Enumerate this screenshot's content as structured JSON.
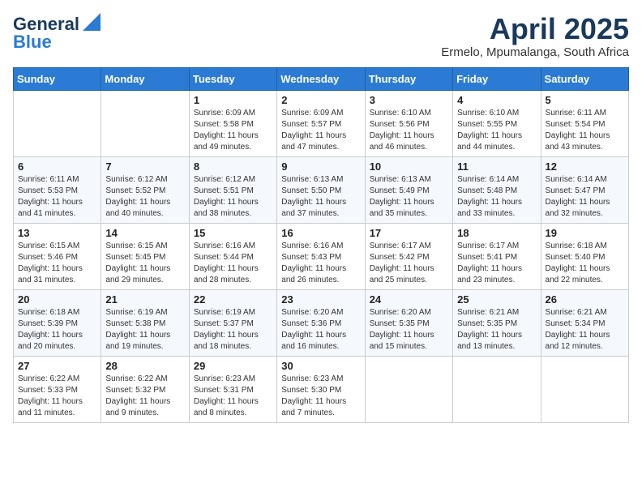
{
  "logo": {
    "line1": "General",
    "line2": "Blue"
  },
  "title": "April 2025",
  "location": "Ermelo, Mpumalanga, South Africa",
  "days_of_week": [
    "Sunday",
    "Monday",
    "Tuesday",
    "Wednesday",
    "Thursday",
    "Friday",
    "Saturday"
  ],
  "weeks": [
    [
      {
        "day": "",
        "info": ""
      },
      {
        "day": "",
        "info": ""
      },
      {
        "day": "1",
        "info": "Sunrise: 6:09 AM\nSunset: 5:58 PM\nDaylight: 11 hours and 49 minutes."
      },
      {
        "day": "2",
        "info": "Sunrise: 6:09 AM\nSunset: 5:57 PM\nDaylight: 11 hours and 47 minutes."
      },
      {
        "day": "3",
        "info": "Sunrise: 6:10 AM\nSunset: 5:56 PM\nDaylight: 11 hours and 46 minutes."
      },
      {
        "day": "4",
        "info": "Sunrise: 6:10 AM\nSunset: 5:55 PM\nDaylight: 11 hours and 44 minutes."
      },
      {
        "day": "5",
        "info": "Sunrise: 6:11 AM\nSunset: 5:54 PM\nDaylight: 11 hours and 43 minutes."
      }
    ],
    [
      {
        "day": "6",
        "info": "Sunrise: 6:11 AM\nSunset: 5:53 PM\nDaylight: 11 hours and 41 minutes."
      },
      {
        "day": "7",
        "info": "Sunrise: 6:12 AM\nSunset: 5:52 PM\nDaylight: 11 hours and 40 minutes."
      },
      {
        "day": "8",
        "info": "Sunrise: 6:12 AM\nSunset: 5:51 PM\nDaylight: 11 hours and 38 minutes."
      },
      {
        "day": "9",
        "info": "Sunrise: 6:13 AM\nSunset: 5:50 PM\nDaylight: 11 hours and 37 minutes."
      },
      {
        "day": "10",
        "info": "Sunrise: 6:13 AM\nSunset: 5:49 PM\nDaylight: 11 hours and 35 minutes."
      },
      {
        "day": "11",
        "info": "Sunrise: 6:14 AM\nSunset: 5:48 PM\nDaylight: 11 hours and 33 minutes."
      },
      {
        "day": "12",
        "info": "Sunrise: 6:14 AM\nSunset: 5:47 PM\nDaylight: 11 hours and 32 minutes."
      }
    ],
    [
      {
        "day": "13",
        "info": "Sunrise: 6:15 AM\nSunset: 5:46 PM\nDaylight: 11 hours and 31 minutes."
      },
      {
        "day": "14",
        "info": "Sunrise: 6:15 AM\nSunset: 5:45 PM\nDaylight: 11 hours and 29 minutes."
      },
      {
        "day": "15",
        "info": "Sunrise: 6:16 AM\nSunset: 5:44 PM\nDaylight: 11 hours and 28 minutes."
      },
      {
        "day": "16",
        "info": "Sunrise: 6:16 AM\nSunset: 5:43 PM\nDaylight: 11 hours and 26 minutes."
      },
      {
        "day": "17",
        "info": "Sunrise: 6:17 AM\nSunset: 5:42 PM\nDaylight: 11 hours and 25 minutes."
      },
      {
        "day": "18",
        "info": "Sunrise: 6:17 AM\nSunset: 5:41 PM\nDaylight: 11 hours and 23 minutes."
      },
      {
        "day": "19",
        "info": "Sunrise: 6:18 AM\nSunset: 5:40 PM\nDaylight: 11 hours and 22 minutes."
      }
    ],
    [
      {
        "day": "20",
        "info": "Sunrise: 6:18 AM\nSunset: 5:39 PM\nDaylight: 11 hours and 20 minutes."
      },
      {
        "day": "21",
        "info": "Sunrise: 6:19 AM\nSunset: 5:38 PM\nDaylight: 11 hours and 19 minutes."
      },
      {
        "day": "22",
        "info": "Sunrise: 6:19 AM\nSunset: 5:37 PM\nDaylight: 11 hours and 18 minutes."
      },
      {
        "day": "23",
        "info": "Sunrise: 6:20 AM\nSunset: 5:36 PM\nDaylight: 11 hours and 16 minutes."
      },
      {
        "day": "24",
        "info": "Sunrise: 6:20 AM\nSunset: 5:35 PM\nDaylight: 11 hours and 15 minutes."
      },
      {
        "day": "25",
        "info": "Sunrise: 6:21 AM\nSunset: 5:35 PM\nDaylight: 11 hours and 13 minutes."
      },
      {
        "day": "26",
        "info": "Sunrise: 6:21 AM\nSunset: 5:34 PM\nDaylight: 11 hours and 12 minutes."
      }
    ],
    [
      {
        "day": "27",
        "info": "Sunrise: 6:22 AM\nSunset: 5:33 PM\nDaylight: 11 hours and 11 minutes."
      },
      {
        "day": "28",
        "info": "Sunrise: 6:22 AM\nSunset: 5:32 PM\nDaylight: 11 hours and 9 minutes."
      },
      {
        "day": "29",
        "info": "Sunrise: 6:23 AM\nSunset: 5:31 PM\nDaylight: 11 hours and 8 minutes."
      },
      {
        "day": "30",
        "info": "Sunrise: 6:23 AM\nSunset: 5:30 PM\nDaylight: 11 hours and 7 minutes."
      },
      {
        "day": "",
        "info": ""
      },
      {
        "day": "",
        "info": ""
      },
      {
        "day": "",
        "info": ""
      }
    ]
  ]
}
